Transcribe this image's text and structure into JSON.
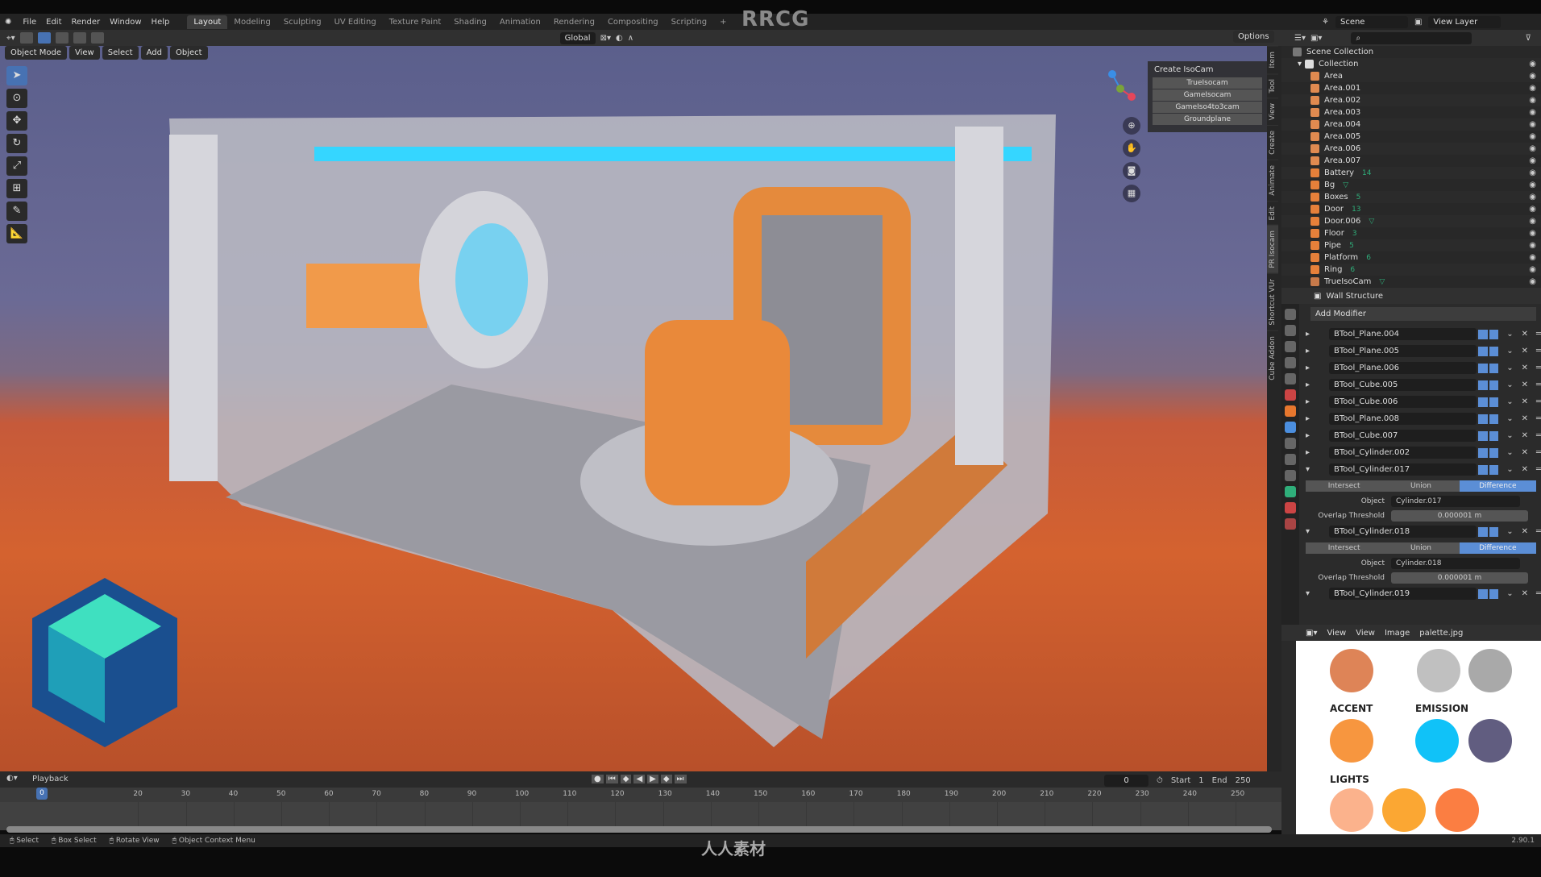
{
  "watermark": "RRCG",
  "bottom_logo": "人人素材",
  "menu": [
    "File",
    "Edit",
    "Render",
    "Window",
    "Help"
  ],
  "workspaces": [
    "Layout",
    "Modeling",
    "Sculpting",
    "UV Editing",
    "Texture Paint",
    "Shading",
    "Animation",
    "Rendering",
    "Compositing",
    "Scripting",
    "+"
  ],
  "active_workspace": "Layout",
  "scene": {
    "scene_name": "Scene",
    "view_layer": "View Layer"
  },
  "tool_header": {
    "orientation": "Global"
  },
  "viewport": {
    "mode": "Object Mode",
    "menus": [
      "View",
      "Select",
      "Add",
      "Object"
    ],
    "options": "Options",
    "tools": [
      "cursor-select",
      "cursor",
      "move",
      "rotate",
      "scale",
      "transform",
      "annotate",
      "measure"
    ]
  },
  "npanel": {
    "title": "Create IsoCam",
    "buttons": [
      "TrueIsocam",
      "GameIsocam",
      "GameIso4to3cam",
      "Groundplane"
    ],
    "tabs": [
      "Item",
      "Tool",
      "View",
      "Create",
      "Animate",
      "Edit",
      "PR Isocam",
      "Shortcut VUr",
      "Cube Addon"
    ],
    "active_tab": "PR Isocam"
  },
  "outliner": {
    "root": "Scene Collection",
    "collection": "Collection",
    "items": [
      {
        "name": "Area",
        "type": "light"
      },
      {
        "name": "Area.001",
        "type": "light"
      },
      {
        "name": "Area.002",
        "type": "light"
      },
      {
        "name": "Area.003",
        "type": "light"
      },
      {
        "name": "Area.004",
        "type": "light"
      },
      {
        "name": "Area.005",
        "type": "light"
      },
      {
        "name": "Area.006",
        "type": "light"
      },
      {
        "name": "Area.007",
        "type": "light"
      },
      {
        "name": "Battery",
        "type": "mesh",
        "extra": "14"
      },
      {
        "name": "Bg",
        "type": "mesh",
        "extra": ""
      },
      {
        "name": "Boxes",
        "type": "mesh",
        "extra": "5"
      },
      {
        "name": "Door",
        "type": "mesh",
        "extra": "13"
      },
      {
        "name": "Door.006",
        "type": "mesh",
        "extra": ""
      },
      {
        "name": "Floor",
        "type": "mesh",
        "extra": "3"
      },
      {
        "name": "Pipe",
        "type": "mesh",
        "extra": "5"
      },
      {
        "name": "Platform",
        "type": "mesh",
        "extra": "6"
      },
      {
        "name": "Ring",
        "type": "mesh",
        "extra": "6"
      },
      {
        "name": "TrueIsoCam",
        "type": "camera",
        "extra": ""
      }
    ]
  },
  "properties": {
    "object": "Wall Structure",
    "add_modifier": "Add Modifier",
    "collapsed": [
      "BTool_Plane.004",
      "BTool_Plane.005",
      "BTool_Plane.006",
      "BTool_Cube.005",
      "BTool_Cube.006",
      "BTool_Plane.008",
      "BTool_Cube.007",
      "BTool_Cylinder.002"
    ],
    "expanded": [
      {
        "name": "BTool_Cylinder.017",
        "operations": [
          "Intersect",
          "Union",
          "Difference"
        ],
        "active": "Difference",
        "object_label": "Object",
        "object": "Cylinder.017",
        "threshold_label": "Overlap Threshold",
        "threshold": "0.000001 m"
      },
      {
        "name": "BTool_Cylinder.018",
        "operations": [
          "Intersect",
          "Union",
          "Difference"
        ],
        "active": "Difference",
        "object_label": "Object",
        "object": "Cylinder.018",
        "threshold_label": "Overlap Threshold",
        "threshold": "0.000001 m"
      }
    ],
    "last": "BTool_Cylinder.019"
  },
  "image_editor": {
    "menus": [
      "View",
      "View",
      "Image"
    ],
    "image": "palette.jpg",
    "palette": {
      "labels": [
        "ACCENT",
        "EMISSION",
        "LIGHTS"
      ],
      "colors": {
        "bg": "#de8457",
        "metal1": "#c0c0c0",
        "metal2": "#a9a9a9",
        "accent": "#f7963f",
        "emission1": "#10c2f8",
        "emission2": "#615d80",
        "light1": "#fbb28c",
        "light2": "#fba733",
        "light3": "#fb7e42"
      }
    }
  },
  "timeline": {
    "playback": "Playback",
    "current_frame": "0",
    "start_label": "Start",
    "start": "1",
    "end_label": "End",
    "end": "250",
    "ticks": [
      "0",
      "20",
      "30",
      "40",
      "50",
      "60",
      "70",
      "80",
      "90",
      "100",
      "110",
      "120",
      "130",
      "140",
      "150",
      "160",
      "170",
      "180",
      "190",
      "200",
      "210",
      "220",
      "230",
      "240",
      "250"
    ]
  },
  "status": {
    "items": [
      "Select",
      "Box Select",
      "Rotate View",
      "Object Context Menu"
    ],
    "version": "2.90.1"
  }
}
